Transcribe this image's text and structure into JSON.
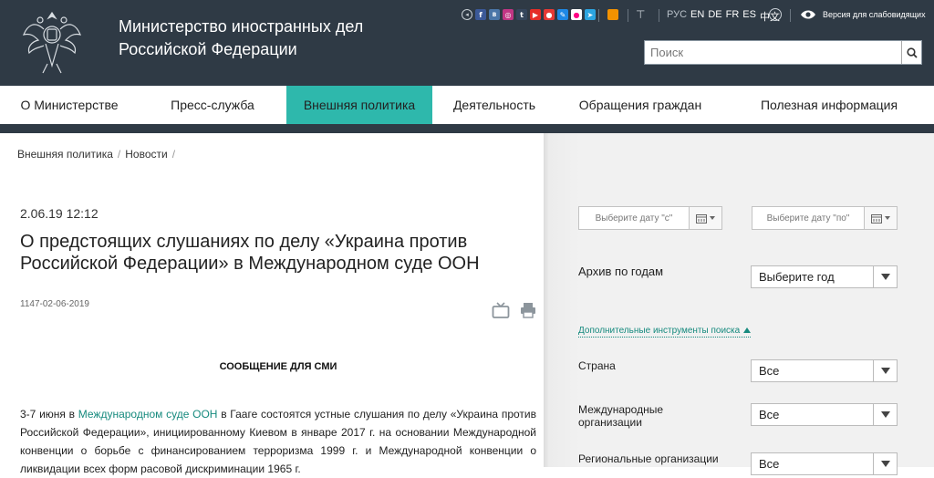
{
  "header": {
    "title_line1": "Министерство иностранных дел",
    "title_line2": "Российской Федерации",
    "social_icons": [
      "share-icon",
      "facebook-icon",
      "vk-icon",
      "instagram-icon",
      "tumblr-icon",
      "youtube-icon",
      "maps-icon",
      "livejournal-icon",
      "flickr-icon",
      "telegram-icon"
    ],
    "languages": [
      {
        "label": "РУС",
        "current": true
      },
      {
        "label": "EN",
        "current": false
      },
      {
        "label": "DE",
        "current": false
      },
      {
        "label": "FR",
        "current": false
      },
      {
        "label": "ES",
        "current": false
      },
      {
        "label": "中文",
        "current": false
      }
    ],
    "impaired_label": "Версия для слабовидящих",
    "search_placeholder": "Поиск"
  },
  "nav": {
    "items": [
      {
        "label": "О Министерстве",
        "active": false
      },
      {
        "label": "Пресс-служба",
        "active": false
      },
      {
        "label": "Внешняя политика",
        "active": true
      },
      {
        "label": "Деятельность",
        "active": false
      },
      {
        "label": "Обращения граждан",
        "active": false
      },
      {
        "label": "Полезная информация",
        "active": false
      }
    ]
  },
  "breadcrumb": [
    "Внешняя политика",
    "Новости"
  ],
  "article": {
    "date": "2.06.19 12:12",
    "headline": "О предстоящих слушаниях по делу «Украина против Российской Федерации» в Международном суде ООН",
    "doc_number": "1147-02-06-2019",
    "section_title": "СООБЩЕНИЕ ДЛЯ СМИ",
    "body_prefix": "3-7 июня в ",
    "body_link": "Международном суде ООН",
    "body_rest": " в Гааге состоятся устные слушания по делу «Украина против Российской Федерации», инициированному Киевом в январе 2017 г. на основании Международной конвенции о борьбе с финансированием терроризма 1999 г. и Международной конвенции о ликвидации всех форм расовой дискриминации 1965 г."
  },
  "sidebar": {
    "date_from_placeholder": "Выберите дату \"с\"",
    "date_to_placeholder": "Выберите дату \"по\"",
    "archive_label": "Архив по годам",
    "year_select": "Выберите год",
    "tools_link": "Дополнительные инструменты поиска",
    "country_label": "Страна",
    "country_select": "Все",
    "intl_org_label": "Международные организации",
    "intl_org_select": "Все",
    "regional_org_label": "Региональные организации",
    "regional_org_select": "Все"
  },
  "colors": {
    "header_bg": "#2f3a45",
    "accent": "#2eb8ac",
    "link": "#168a7e",
    "sidebar_bg": "#f1f1f1"
  }
}
